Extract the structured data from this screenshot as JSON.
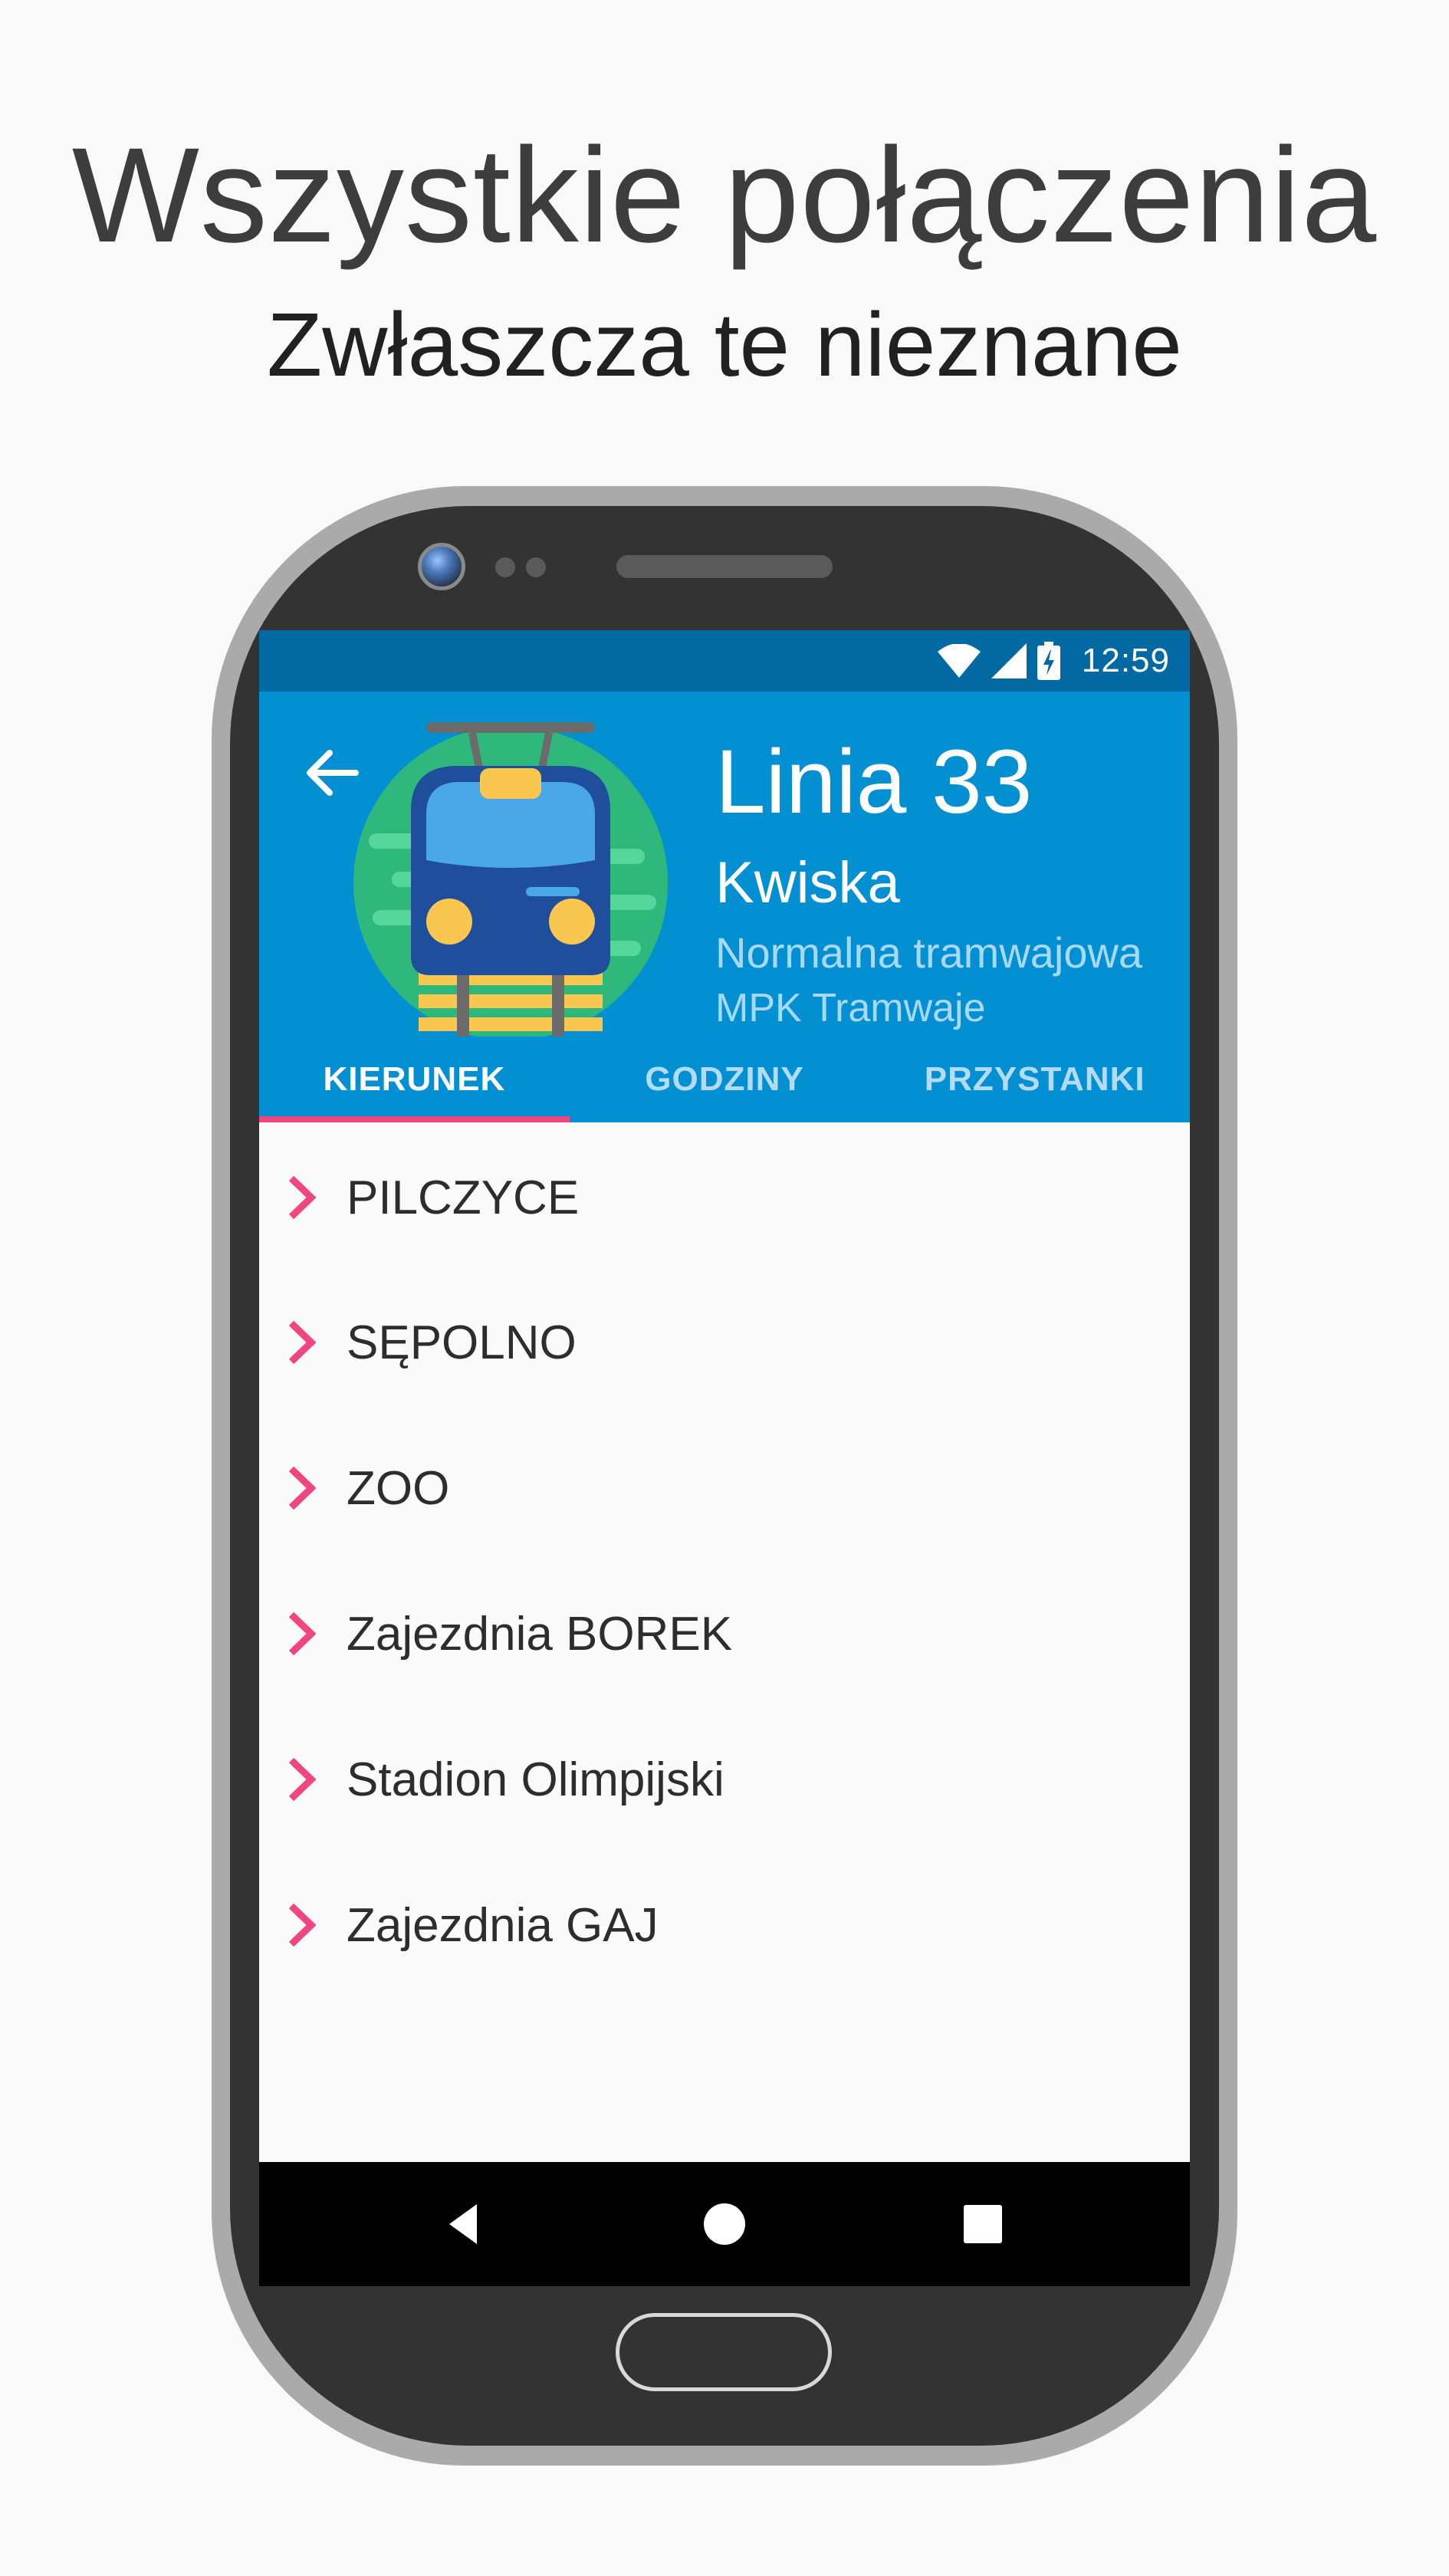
{
  "promo": {
    "headline": "Wszystkie połączenia",
    "subheadline": "Zwłaszcza te nieznane"
  },
  "status_bar": {
    "time": "12:59",
    "icons": [
      "wifi-icon",
      "cell-signal-icon",
      "battery-charging-icon"
    ]
  },
  "header": {
    "back_icon": "arrow-back-icon",
    "hero_icon": "tram-front-icon",
    "title": "Linia 33",
    "subtitle": "Kwiska",
    "line_type": "Normalna tramwajowa",
    "operator": "MPK Tramwaje"
  },
  "tabs": [
    {
      "label": "KIERUNEK",
      "active": true
    },
    {
      "label": "GODZINY",
      "active": false
    },
    {
      "label": "PRZYSTANKI",
      "active": false
    }
  ],
  "directions": [
    "PILCZYCE",
    "SĘPOLNO",
    "ZOO",
    "Zajezdnia BOREK",
    "Stadion Olimpijski",
    "Zajezdnia GAJ"
  ],
  "nav_bar": {
    "icons": [
      "nav-back-icon",
      "nav-home-icon",
      "nav-recents-icon"
    ]
  },
  "colors": {
    "status_bar": "#0369a3",
    "header": "#0390d3",
    "accent": "#f0457f",
    "inactive_tab_text": "#b3dcf3",
    "background": "#f9f9f9",
    "device_body": "#333333"
  }
}
